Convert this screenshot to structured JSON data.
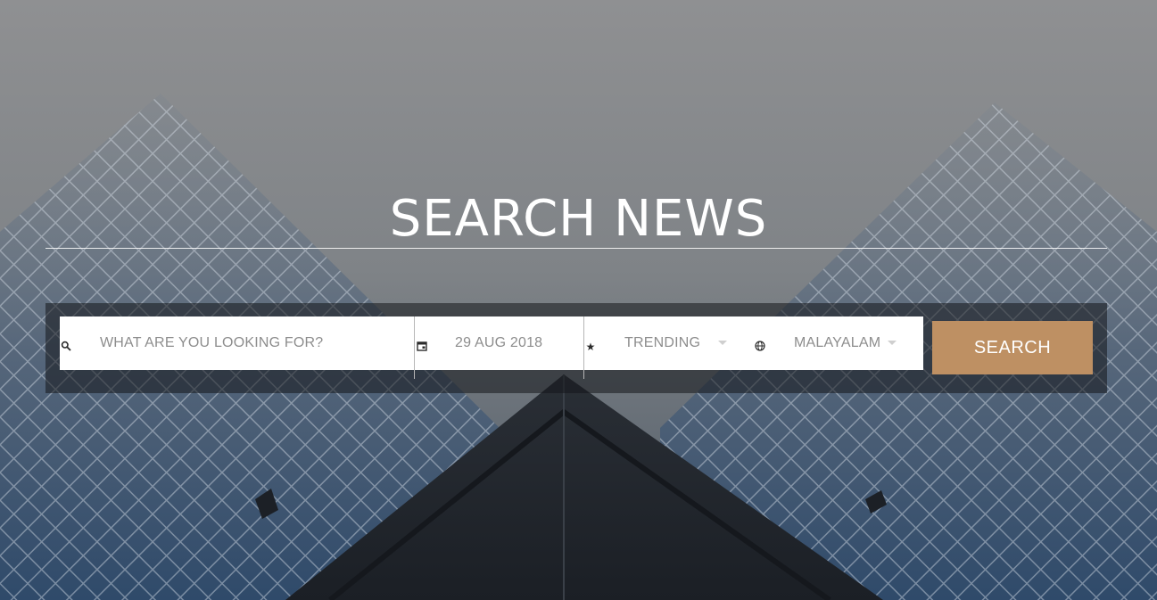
{
  "hero": {
    "title": "SEARCH NEWS"
  },
  "search": {
    "query_placeholder": "WHAT ARE YOU LOOKING FOR?",
    "query_value": "",
    "date_value": "29 AUG 2018",
    "category_value": "TRENDING",
    "language_value": "MALAYALAM",
    "submit_label": "SEARCH"
  },
  "icons": {
    "query": "search-icon",
    "date": "calendar-icon",
    "category": "star-icon",
    "language": "globe-icon"
  },
  "colors": {
    "accent": "#be9063",
    "panel": "#14161a",
    "text_muted": "#8d8d8d"
  }
}
